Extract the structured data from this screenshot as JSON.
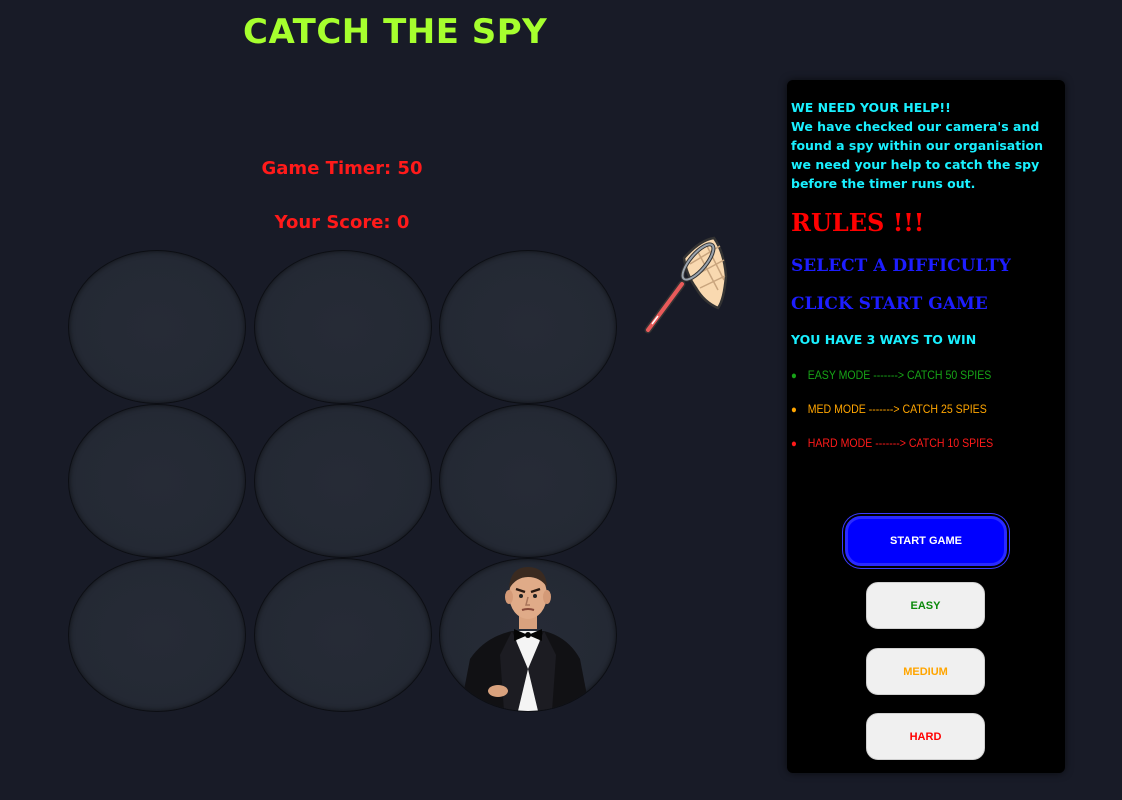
{
  "game": {
    "title": "CATCH THE SPY",
    "timer_label": "Game Timer: 50",
    "score_label": "Your Score: 0",
    "holes": [
      {
        "id": 1,
        "has_spy": false
      },
      {
        "id": 2,
        "has_spy": false
      },
      {
        "id": 3,
        "has_spy": false
      },
      {
        "id": 4,
        "has_spy": false
      },
      {
        "id": 5,
        "has_spy": false
      },
      {
        "id": 6,
        "has_spy": false
      },
      {
        "id": 7,
        "has_spy": false
      },
      {
        "id": 8,
        "has_spy": false
      },
      {
        "id": 9,
        "has_spy": true
      }
    ],
    "cursor_icon": "butterfly-net-icon",
    "spy_icon": "spy-character"
  },
  "panel": {
    "help_title": "WE NEED YOUR HELP!!",
    "help_text": "We have checked our camera's and found a spy within our organisation we need your help to catch the spy before the timer runs out.",
    "rules_title": "RULES !!!",
    "step1": "SELECT A DIFFICULTY",
    "step2": "CLICK START GAME",
    "ways_title": "YOU HAVE 3 WAYS TO WIN",
    "modes": [
      {
        "label": "EASY MODE -------> CATCH 50 SPIES",
        "color": "#17a317"
      },
      {
        "label": "MED MODE -------> CATCH 25 SPIES",
        "color": "#ffa500"
      },
      {
        "label": "HARD MODE -------> CATCH 10 SPIES",
        "color": "#ff1a1a"
      }
    ],
    "buttons": {
      "start": "START GAME",
      "easy": "EASY",
      "medium": "MEDIUM",
      "hard": "HARD"
    }
  },
  "colors": {
    "background": "#181b27",
    "title": "#a6ff2e",
    "timer": "#ff1a1a",
    "help_text": "#19f0ff",
    "rules": "#ff0000",
    "steps": "#1d1dff",
    "start_button": "#0000ff"
  }
}
